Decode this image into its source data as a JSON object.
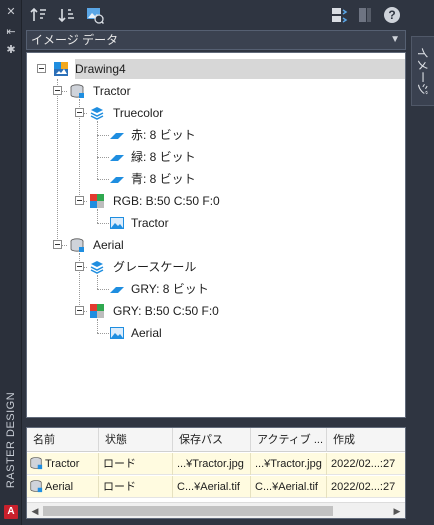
{
  "side_panel": {
    "vertical_label": "RASTER DESIGN",
    "logo_letter": "A"
  },
  "right_tab": {
    "label": "イメージ"
  },
  "toolbar": {
    "buttons": [
      "sort-ascending-icon",
      "sort-descending-icon",
      "image-insert-icon",
      "image-manage-icon",
      "image-disabled-icon",
      "help-icon"
    ],
    "help_label": "?"
  },
  "dropdown": {
    "value": "イメージ データ"
  },
  "tree": {
    "root": "Drawing4",
    "nodes": [
      {
        "label": "Tractor"
      },
      {
        "label": "Truecolor"
      },
      {
        "label": "赤: 8 ビット"
      },
      {
        "label": "緑: 8 ビット"
      },
      {
        "label": "青: 8 ビット"
      },
      {
        "label": "RGB: B:50 C:50 F:0"
      },
      {
        "label": "Tractor"
      },
      {
        "label": "Aerial"
      },
      {
        "label": "グレースケール"
      },
      {
        "label": "GRY: 8 ビット"
      },
      {
        "label": "GRY: B:50 C:50 F:0"
      },
      {
        "label": "Aerial"
      }
    ]
  },
  "table": {
    "headers": [
      "名前",
      "状態",
      "保存パス",
      "アクティブ ...",
      "作成"
    ],
    "rows": [
      {
        "name": "Tractor",
        "status": "ロード",
        "path": "...¥Tractor.jpg",
        "active": "...¥Tractor.jpg",
        "created": "2022/02...:27"
      },
      {
        "name": "Aerial",
        "status": "ロード",
        "path": "C...¥Aerial.tif",
        "active": "C...¥Aerial.tif",
        "created": "2022/02...:27"
      }
    ]
  },
  "colors": {
    "background": "#2f3541",
    "tree_background": "#ffffff",
    "selection": "#d7d7d7",
    "row_highlight": "#fffbe0",
    "accent_blue": "#1f8ee0"
  }
}
